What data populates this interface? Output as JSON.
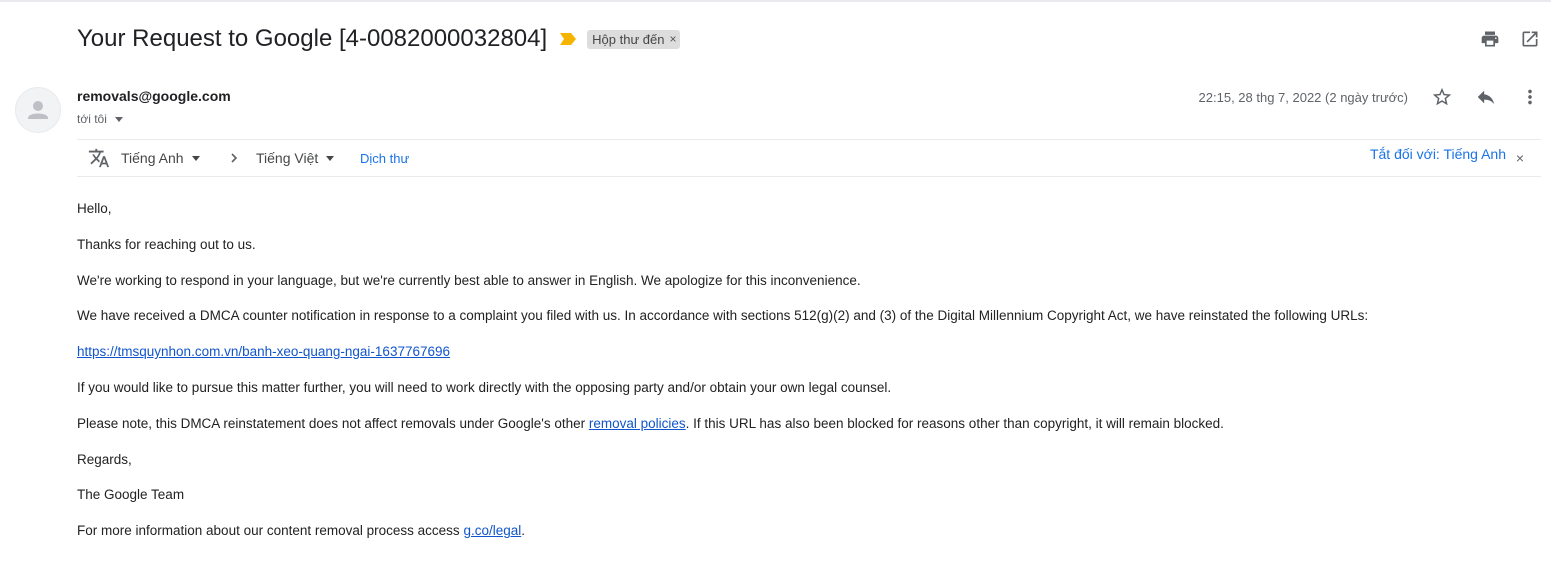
{
  "email": {
    "subject": "Your Request to Google [4-0082000032804]",
    "label": "Hộp thư đến",
    "label_remove": "×",
    "sender": "removals@google.com",
    "recipient": "tới tôi",
    "date": "22:15, 28 thg 7, 2022 (2 ngày trước)",
    "importance_color": "#f4b400"
  },
  "toolbar": {
    "print_icon": "print-icon",
    "open_new_window_icon": "open-in-new-icon",
    "star_icon": "star-icon",
    "reply_icon": "reply-icon",
    "more_icon": "more-vert-icon"
  },
  "translate": {
    "source_language": "Tiếng Anh",
    "target_language": "Tiếng Việt",
    "translate_link": "Dịch thư",
    "turn_off_label": "Tắt đối với: Tiếng Anh",
    "close": "×"
  },
  "body": {
    "p1": "Hello,",
    "p2": "Thanks for reaching out to us.",
    "p3": "We're working to respond in your language, but we're currently best able to answer in English. We apologize for this inconvenience.",
    "p4": "We have received a DMCA counter notification in response to a complaint you filed with us. In accordance with sections 512(g)(2) and (3) of the Digital Millennium Copyright Act, we have reinstated the following URLs:",
    "url": "https://tmsquynhon.com.vn/banh-xeo-quang-ngai-1637767696",
    "p6": "If you would like to pursue this matter further, you will need to work directly with the opposing party and/or obtain your own legal counsel.",
    "p7_before": "Please note, this DMCA reinstatement does not affect removals under Google's other ",
    "p7_link": "removal policies",
    "p7_after": ". If this URL has also been blocked for reasons other than copyright, it will remain blocked.",
    "p8": "Regards,",
    "p9": "The Google Team",
    "p10_before": "For more information about our content removal process access ",
    "p10_link": "g.co/legal",
    "p10_after": "."
  }
}
